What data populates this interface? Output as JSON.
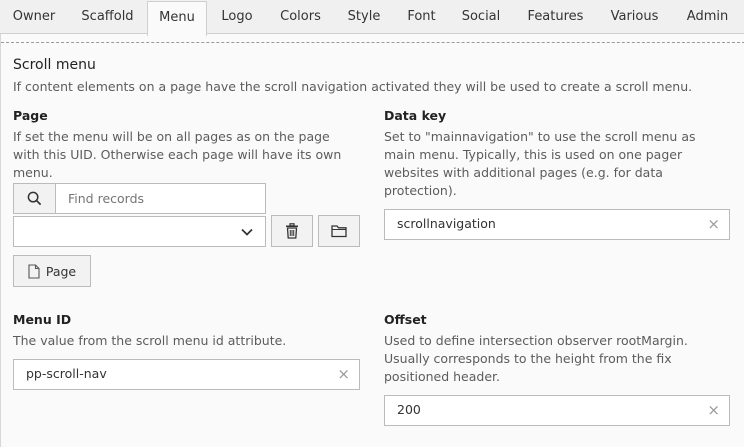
{
  "tabs": [
    {
      "label": "Owner"
    },
    {
      "label": "Scaffold"
    },
    {
      "label": "Menu",
      "active": true
    },
    {
      "label": "Logo"
    },
    {
      "label": "Colors"
    },
    {
      "label": "Style"
    },
    {
      "label": "Font"
    },
    {
      "label": "Social"
    },
    {
      "label": "Features"
    },
    {
      "label": "Various"
    },
    {
      "label": "Admin"
    }
  ],
  "section": {
    "title": "Scroll menu",
    "description": "If content elements on a page have the scroll navigation activated they will be used to create a scroll menu."
  },
  "page_field": {
    "label": "Page",
    "description_lines": [
      "If set the menu will be on all pages as on the page",
      "with this UID. Otherwise each page will have its own",
      "menu."
    ],
    "find_placeholder": "Find records",
    "select_value": "",
    "page_button_label": "Page"
  },
  "data_key_field": {
    "label": "Data key",
    "description_lines": [
      "Set to \"mainnavigation\" to use the scroll menu as",
      "main menu. Typically, this is used on one pager",
      "websites with additional pages (e.g. for data",
      "protection)."
    ],
    "value": "scrollnavigation"
  },
  "menu_id_field": {
    "label": "Menu ID",
    "description": "The value from the scroll menu id attribute.",
    "value": "pp-scroll-nav"
  },
  "offset_field": {
    "label": "Offset",
    "description_lines": [
      "Used to define intersection observer rootMargin.",
      "Usually corresponds to the height from the fix",
      "positioned header."
    ],
    "value": "200"
  },
  "icons": {
    "search": "search-icon",
    "chevron": "chevron-down-icon",
    "trash": "trash-icon",
    "folder": "folder-icon",
    "page": "page-icon",
    "clear": "clear-icon"
  },
  "colors": {
    "tabbar_bg": "#f0f0f0",
    "panel_bg": "#fafafa",
    "border": "#bbbbbb"
  },
  "clear_glyph": "×"
}
